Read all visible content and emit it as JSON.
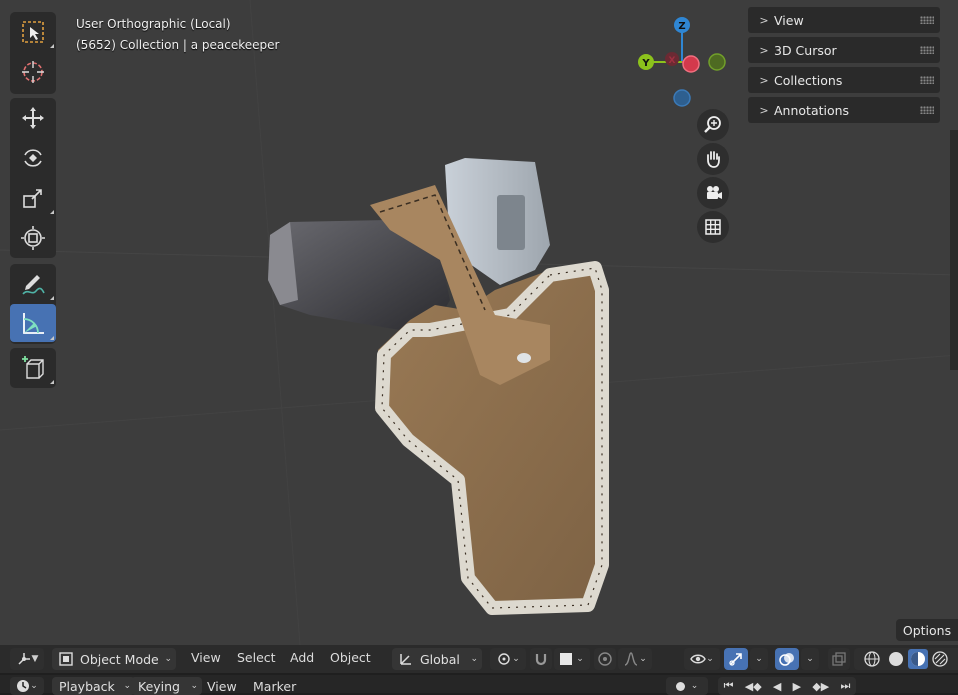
{
  "viewport": {
    "view_name": "User Orthographic (Local)",
    "collection_info": "(5652) Collection | a peacekeeper"
  },
  "gizmo": {
    "z": "Z",
    "y": "Y",
    "x": "X",
    "x_color": "#d3394c",
    "y_color": "#8cc21c",
    "z_color": "#2f86d3"
  },
  "toolbar": {
    "tools": [
      {
        "name": "select-box",
        "icon": "select-box-icon",
        "active": false
      },
      {
        "name": "cursor",
        "icon": "cursor-icon",
        "active": false
      },
      {
        "name": "move",
        "icon": "move-icon",
        "active": false
      },
      {
        "name": "rotate",
        "icon": "rotate-icon",
        "active": false
      },
      {
        "name": "scale",
        "icon": "scale-icon",
        "active": false
      },
      {
        "name": "transform",
        "icon": "transform-icon",
        "active": false
      },
      {
        "name": "annotate",
        "icon": "annotate-icon",
        "active": false
      },
      {
        "name": "measure",
        "icon": "measure-icon",
        "active": true
      },
      {
        "name": "add-cube",
        "icon": "add-cube-icon",
        "active": false
      }
    ],
    "active_color": "#4772b3"
  },
  "nav_buttons": [
    "zoom-icon",
    "pan-hand-icon",
    "camera-icon",
    "grid-icon"
  ],
  "sidebar": {
    "panels": [
      {
        "label": "View"
      },
      {
        "label": "3D Cursor"
      },
      {
        "label": "Collections"
      },
      {
        "label": "Annotations"
      }
    ]
  },
  "options_label": "Options",
  "header": {
    "mode": "Object Mode",
    "menus": [
      "View",
      "Select",
      "Add",
      "Object"
    ],
    "orientation": "Global"
  },
  "timeline": {
    "menus": [
      "Playback",
      "Keying",
      "View",
      "Marker"
    ]
  }
}
